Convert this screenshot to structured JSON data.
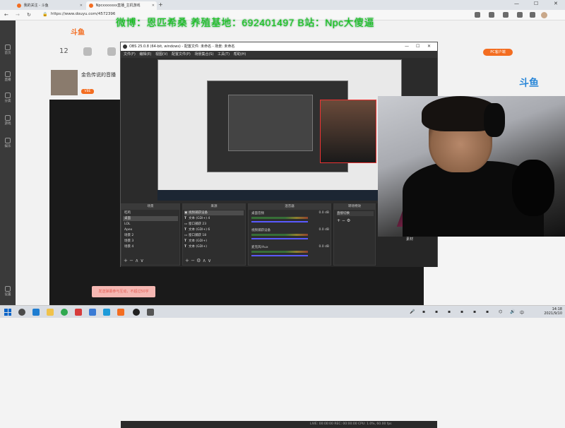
{
  "browser": {
    "tabs": [
      {
        "label": "我的关注 - 斗鱼",
        "active": false
      },
      {
        "label": "Npcxxxxxxx直播_主机游戏",
        "active": true
      }
    ],
    "new_tab": "+",
    "url": "https://www.douyu.com/4572396",
    "window_controls": {
      "minimize": "—",
      "maximize": "☐",
      "close": "✕"
    }
  },
  "overlay_text": "微博：恩匹希桑 养殖基地：692401497 B站：Npc大傻逼",
  "page": {
    "logo": "斗鱼",
    "follow_count": "12",
    "anchor_title": "金色传说的音播",
    "anchor_tag": "VBE",
    "pc_download": "PC客户端",
    "mascot": "斗鱼",
    "chat_placeholder": "发送弹幕参与互动，不超过50字",
    "sidenav": [
      "首页",
      "直播",
      "分类",
      "游戏",
      "娱乐",
      "设置"
    ]
  },
  "obs": {
    "title": "OBS 25.0.8 (64-bit, windows) - 配置文件: 未命名 - 场景: 未命名",
    "menu": [
      "文件(F)",
      "编辑(E)",
      "视图(V)",
      "配置文件(P)",
      "场景集合(S)",
      "工具(T)",
      "帮助(H)"
    ],
    "panels": {
      "scenes": "场景",
      "sources": "来源",
      "mixer": "混音器",
      "transitions": "转场特效"
    },
    "scenes": [
      "吃鸡",
      "桌面",
      "LOL",
      "Apex",
      "场景 2",
      "场景 3",
      "场景 4"
    ],
    "sources": [
      {
        "icon": "camera",
        "label": "视频捕获设备"
      },
      {
        "icon": "text",
        "label": "文本 (GDI+) 4"
      },
      {
        "icon": "window",
        "label": "窗口捕获 23"
      },
      {
        "icon": "text",
        "label": "文本 (GDI+) 6"
      },
      {
        "icon": "window",
        "label": "窗口捕获 18"
      },
      {
        "icon": "text",
        "label": "文本 (GDI+)"
      },
      {
        "icon": "text",
        "label": "文本 (GDI+)"
      }
    ],
    "mixer": [
      {
        "label": "桌面音频",
        "db": "0.0 dB"
      },
      {
        "label": "视频捕获设备",
        "db": "0.0 dB"
      },
      {
        "label": "麦克风/Aux",
        "db": "0.0 dB"
      }
    ],
    "transition_value": "直接切换",
    "status": "LIVE: 00:00:00   REC: 00:00:00   CPU: 1.0%, 60.00 fps",
    "webcam_caption": "素材"
  },
  "taskbar": {
    "time": "14:18",
    "date": "2021/9/10"
  },
  "colors": {
    "douyu_orange": "#f36d21",
    "overlay_green": "#17c417",
    "obs_bg": "#2b2b2b"
  }
}
